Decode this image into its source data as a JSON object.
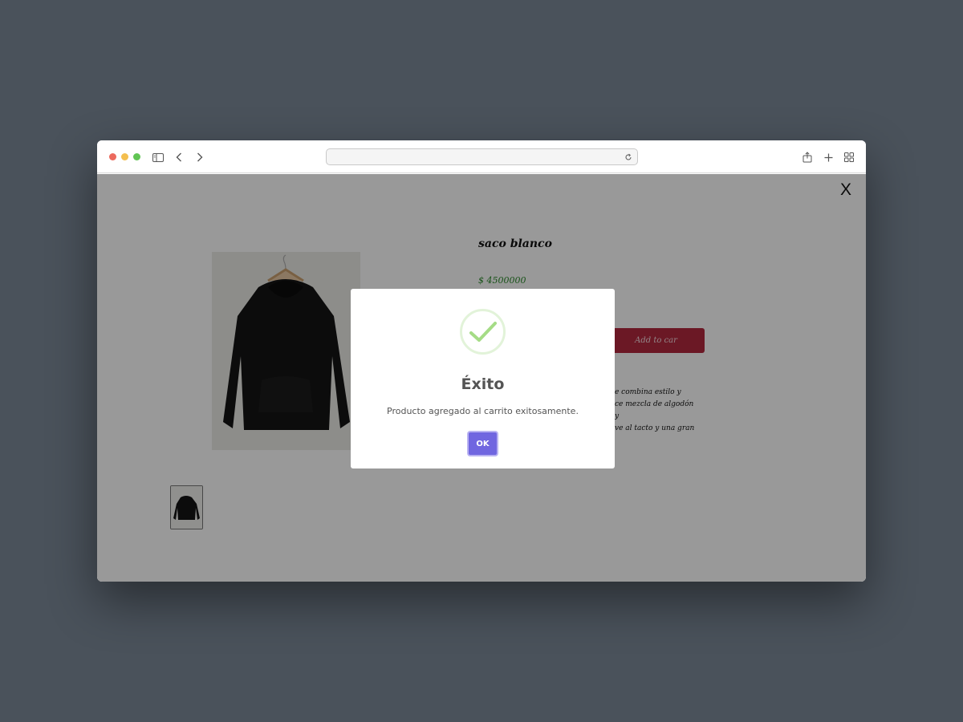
{
  "browser": {
    "address_value": "",
    "icons": [
      "sidebar-toggle-icon",
      "chevron-left-icon",
      "chevron-right-icon",
      "reload-icon",
      "share-icon",
      "plus-icon",
      "tab-overview-icon"
    ]
  },
  "product": {
    "close_label": "X",
    "name": "saco blanco",
    "price": "$ 4500000",
    "add_to_cart_label": "Add to car",
    "description_lines": [
      "e combina estilo y",
      "ce mezcla de algodón y",
      "ve al tacto y una gran"
    ]
  },
  "modal": {
    "title": "Éxito",
    "message": "Producto agregado al carrito exitosamente.",
    "ok_label": "OK",
    "icon": "check-icon"
  },
  "colors": {
    "background": "#4a525b",
    "price": "#2b8a2b",
    "add_button": "#b3283f",
    "ok_button": "#7066e0",
    "check": "#a5dc86"
  }
}
